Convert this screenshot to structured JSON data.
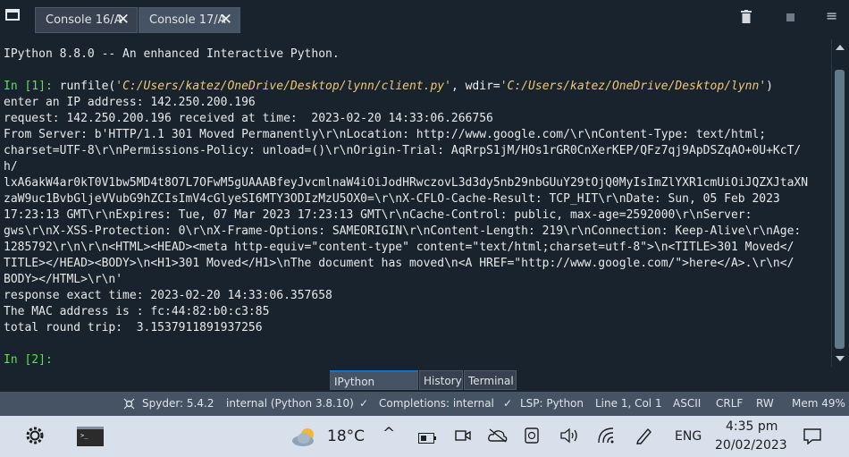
{
  "tabs": [
    {
      "label": "Console 16/A",
      "close": "✕"
    },
    {
      "label": "Console 17/A",
      "close": "✕"
    }
  ],
  "console": {
    "banner": "IPython 8.8.0 -- An enhanced Interactive Python.",
    "cell1": {
      "prompt": "In [1]: ",
      "fn": "runfile(",
      "path": "'C:/Users/katez/OneDrive/Desktop/lynn/client.py'",
      "mid": ", wdir=",
      "wdir": "'C:/Users/katez/OneDrive/Desktop/lynn'",
      "end": ")"
    },
    "output": [
      "enter an IP address: 142.250.200.196",
      "request: 142.250.200.196 received at time:  2023-02-20 14:33:06.266756",
      "From Server: b'HTTP/1.1 301 Moved Permanently\\r\\nLocation: http://www.google.com/\\r\\nContent-Type: text/html;",
      "charset=UTF-8\\r\\nPermissions-Policy: unload=()\\r\\nOrigin-Trial: AqRrpS1jM/HOs1rGR0CnXerKEP/QFz7qj9ApDSZqAO+0U+KcT/",
      "h/",
      "lxA6akW4ar0kT0V1bw5MD4t8O7L7OFwM5gUAAABfeyJvcmlnaW4iOiJodHRwczovL3d3dy5nb29nbGUuY29tOjQ0MyIsImZlYXR1cmUiOiJQZXJtaXN",
      "zaW9uc1BvbGljeVVubG9hZCIsImV4cGlyeSI6MTY3ODIzMzU5OX0=\\r\\nX-CFLO-Cache-Result: TCP_HIT\\r\\nDate: Sun, 05 Feb 2023",
      "17:23:13 GMT\\r\\nExpires: Tue, 07 Mar 2023 17:23:13 GMT\\r\\nCache-Control: public, max-age=2592000\\r\\nServer:",
      "gws\\r\\nX-XSS-Protection: 0\\r\\nX-Frame-Options: SAMEORIGIN\\r\\nContent-Length: 219\\r\\nConnection: Keep-Alive\\r\\nAge:",
      "1285792\\r\\n\\r\\n<HTML><HEAD><meta http-equiv=\"content-type\" content=\"text/html;charset=utf-8\">\\n<TITLE>301 Moved</",
      "TITLE></HEAD><BODY>\\n<H1>301 Moved</H1>\\nThe document has moved\\n<A HREF=\"http://www.google.com/\">here</A>.\\r\\n</",
      "BODY></HTML>\\r\\n'",
      "response exact time: 2023-02-20 14:33:06.357658",
      "The MAC address is : fc:44:82:b0:c3:85",
      "total round trip:  3.1537911891937256"
    ],
    "prompt2": "In [2]:"
  },
  "bottom_tabs": [
    "IPython Console",
    "History",
    "Terminal"
  ],
  "status": {
    "spyder": "Spyder: 5.4.2",
    "env": "internal (Python 3.8.10)",
    "completions": "Completions: internal",
    "lsp": "LSP: Python",
    "cursor": "Line 1, Col 1",
    "encoding": "ASCII",
    "eol": "CRLF",
    "rw": "RW",
    "mem": "Mem 49%"
  },
  "taskbar": {
    "weather": "18°C",
    "language": "ENG",
    "time": "4:35 pm",
    "date": "20/02/2023"
  },
  "colors": {
    "accent": "#1a72bb",
    "prompt": "#5de054",
    "string": "#f0c674"
  }
}
